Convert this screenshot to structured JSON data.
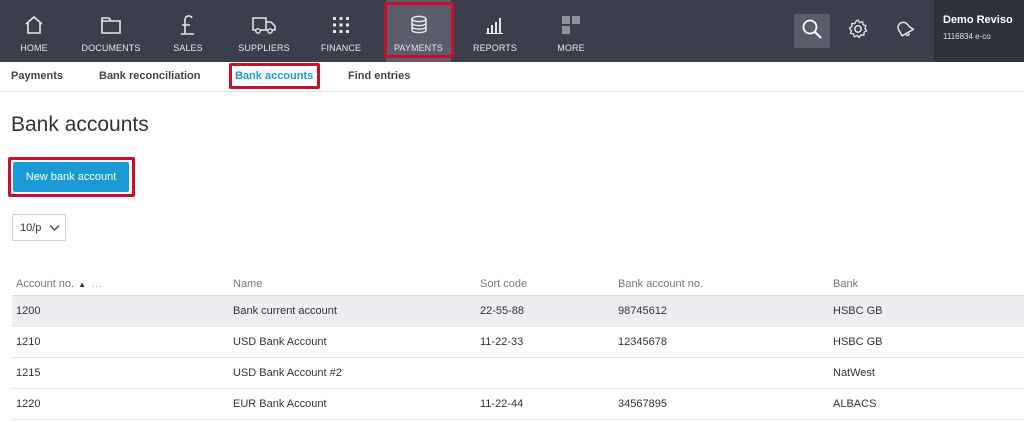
{
  "topnav": {
    "items": [
      {
        "label": "HOME",
        "icon": "home-icon"
      },
      {
        "label": "DOCUMENTS",
        "icon": "folder-icon"
      },
      {
        "label": "SALES",
        "icon": "pound-icon"
      },
      {
        "label": "SUPPLIERS",
        "icon": "truck-icon"
      },
      {
        "label": "FINANCE",
        "icon": "grid-dots-icon"
      },
      {
        "label": "PAYMENTS",
        "icon": "coins-stack-icon"
      },
      {
        "label": "REPORTS",
        "icon": "bar-chart-icon"
      },
      {
        "label": "MORE",
        "icon": "tiles-icon"
      }
    ],
    "active": "PAYMENTS"
  },
  "tools": {
    "search": "search-icon",
    "settings": "gear-icon",
    "notifications": "bell-icon"
  },
  "user": {
    "name": "Demo Reviso",
    "sub": "1116834 e-co"
  },
  "subnav": {
    "items": [
      "Payments",
      "Bank reconciliation",
      "Bank accounts",
      "Find entries"
    ],
    "active": "Bank accounts"
  },
  "page": {
    "title": "Bank accounts",
    "new_button": "New bank account",
    "page_size": "10/p"
  },
  "table": {
    "columns": [
      "Account no.",
      "Name",
      "Sort code",
      "Bank account no.",
      "Bank"
    ],
    "sort_column": "Account no.",
    "rows": [
      {
        "account_no": "1200",
        "name": "Bank current account",
        "sort_code": "22-55-88",
        "bank_account_no": "98745612",
        "bank": "HSBC GB"
      },
      {
        "account_no": "1210",
        "name": "USD Bank Account",
        "sort_code": "11-22-33",
        "bank_account_no": "12345678",
        "bank": "HSBC GB"
      },
      {
        "account_no": "1215",
        "name": "USD Bank Account #2",
        "sort_code": "",
        "bank_account_no": "",
        "bank": "NatWest"
      },
      {
        "account_no": "1220",
        "name": "EUR Bank Account",
        "sort_code": "11-22-44",
        "bank_account_no": "34567895",
        "bank": "ALBACS"
      }
    ]
  },
  "colors": {
    "topbar": "#3b3f4b",
    "accent": "#1a9bd7",
    "highlight_box": "#c8102e"
  }
}
